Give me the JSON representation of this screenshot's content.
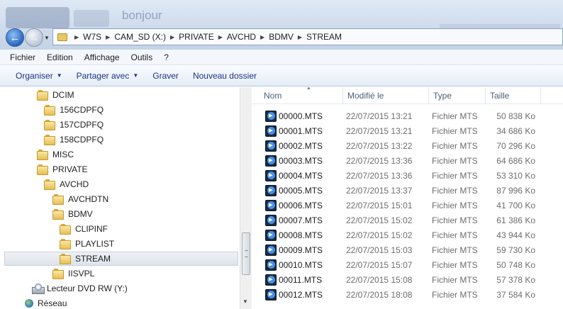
{
  "window": {
    "bg_title": "bonjour"
  },
  "address_bar": {
    "crumbs": [
      "W7S",
      "CAM_SD (X:)",
      "PRIVATE",
      "AVCHD",
      "BDMV",
      "STREAM"
    ]
  },
  "menu": [
    "Fichier",
    "Edition",
    "Affichage",
    "Outils",
    "?"
  ],
  "commands": {
    "organize": "Organiser",
    "share": "Partager avec",
    "burn": "Graver",
    "new_folder": "Nouveau dossier"
  },
  "tree": [
    {
      "label": "DCIM",
      "icon": "folder-icon",
      "level": 0
    },
    {
      "label": "156CDPFQ",
      "icon": "folder-icon",
      "level": 1
    },
    {
      "label": "157CDPFQ",
      "icon": "folder-icon",
      "level": 1
    },
    {
      "label": "158CDPFQ",
      "icon": "folder-icon",
      "level": 1
    },
    {
      "label": "MISC",
      "icon": "folder-icon",
      "level": 0
    },
    {
      "label": "PRIVATE",
      "icon": "folder-icon",
      "level": 0
    },
    {
      "label": "AVCHD",
      "icon": "folder-icon",
      "level": 1
    },
    {
      "label": "AVCHDTN",
      "icon": "folder-icon",
      "level": 2
    },
    {
      "label": "BDMV",
      "icon": "folder-icon",
      "level": 2
    },
    {
      "label": "CLIPINF",
      "icon": "folder-icon",
      "level": 3
    },
    {
      "label": "PLAYLIST",
      "icon": "folder-icon",
      "level": 3
    },
    {
      "label": "STREAM",
      "icon": "folder-icon",
      "level": 3,
      "selected": true
    },
    {
      "label": "IISVPL",
      "icon": "folder-icon",
      "level": 2
    },
    {
      "label": "Lecteur DVD RW (Y:)",
      "icon": "dvd-drive-icon",
      "level": -1
    },
    {
      "label": "Réseau",
      "icon": "network-icon",
      "level": -2
    }
  ],
  "columns": [
    "Nom",
    "Modifié le",
    "Type",
    "Taille"
  ],
  "files": [
    {
      "name": "00000.MTS",
      "date": "22/07/2015 13:21",
      "type": "Fichier MTS",
      "size": "50 838 Ko"
    },
    {
      "name": "00001.MTS",
      "date": "22/07/2015 13:21",
      "type": "Fichier MTS",
      "size": "34 686 Ko"
    },
    {
      "name": "00002.MTS",
      "date": "22/07/2015 13:22",
      "type": "Fichier MTS",
      "size": "70 296 Ko"
    },
    {
      "name": "00003.MTS",
      "date": "22/07/2015 13:36",
      "type": "Fichier MTS",
      "size": "64 686 Ko"
    },
    {
      "name": "00004.MTS",
      "date": "22/07/2015 13:36",
      "type": "Fichier MTS",
      "size": "53 310 Ko"
    },
    {
      "name": "00005.MTS",
      "date": "22/07/2015 13:37",
      "type": "Fichier MTS",
      "size": "87 996 Ko"
    },
    {
      "name": "00006.MTS",
      "date": "22/07/2015 15:01",
      "type": "Fichier MTS",
      "size": "41 700 Ko"
    },
    {
      "name": "00007.MTS",
      "date": "22/07/2015 15:02",
      "type": "Fichier MTS",
      "size": "61 386 Ko"
    },
    {
      "name": "00008.MTS",
      "date": "22/07/2015 15:02",
      "type": "Fichier MTS",
      "size": "43 944 Ko"
    },
    {
      "name": "00009.MTS",
      "date": "22/07/2015 15:03",
      "type": "Fichier MTS",
      "size": "59 730 Ko"
    },
    {
      "name": "00010.MTS",
      "date": "22/07/2015 15:07",
      "type": "Fichier MTS",
      "size": "50 748 Ko"
    },
    {
      "name": "00011.MTS",
      "date": "22/07/2015 15:08",
      "type": "Fichier MTS",
      "size": "57 378 Ko"
    },
    {
      "name": "00012.MTS",
      "date": "22/07/2015 18:08",
      "type": "Fichier MTS",
      "size": "37 584 Ko"
    }
  ]
}
